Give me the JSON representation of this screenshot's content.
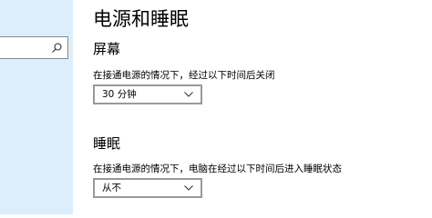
{
  "sidebar": {
    "search": {
      "value": "",
      "placeholder": ""
    }
  },
  "page": {
    "title": "电源和睡眠"
  },
  "screen": {
    "heading": "屏幕",
    "label": "在接通电源的情况下，经过以下时间后关闭",
    "selected": "30 分钟"
  },
  "sleep": {
    "heading": "睡眠",
    "label": "在接通电源的情况下，电脑在经过以下时间后进入睡眠状态",
    "selected": "从不"
  },
  "icons": {
    "search": "search-icon",
    "dropdown": "chevron-down-icon"
  },
  "colors": {
    "sidebar_bg": "#dceefb",
    "border": "#999999"
  }
}
